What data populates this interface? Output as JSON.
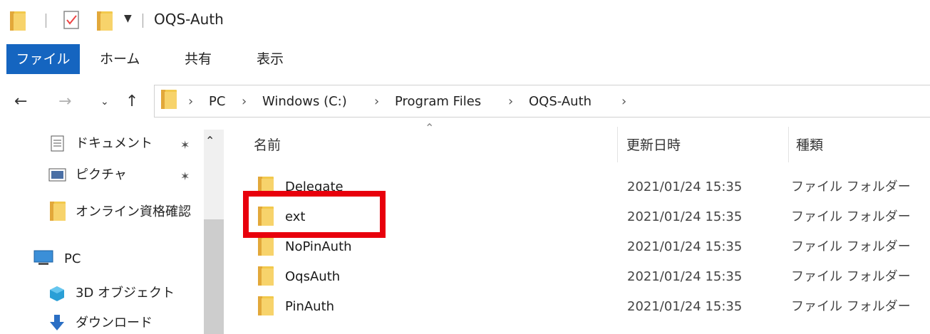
{
  "window": {
    "title": "OQS-Auth"
  },
  "ribbon": {
    "tabs": [
      "ファイル",
      "ホーム",
      "共有",
      "表示"
    ]
  },
  "address": {
    "crumbs": [
      "PC",
      "Windows (C:)",
      "Program Files",
      "OQS-Auth"
    ]
  },
  "sidebar": {
    "items": [
      {
        "label": "ドキュメント",
        "icon": "documents-icon",
        "pinned": true
      },
      {
        "label": "ピクチャ",
        "icon": "pictures-icon",
        "pinned": true
      },
      {
        "label": "オンライン資格確認",
        "icon": "folder-icon",
        "pinned": false
      },
      {
        "label": "PC",
        "icon": "pc-icon",
        "pinned": false
      },
      {
        "label": "3D オブジェクト",
        "icon": "3d-objects-icon",
        "pinned": false
      },
      {
        "label": "ダウンロード",
        "icon": "download-icon",
        "pinned": false
      }
    ]
  },
  "columns": {
    "name": "名前",
    "date": "更新日時",
    "type": "種類"
  },
  "files": [
    {
      "name": "Delegate",
      "date": "2021/01/24 15:35",
      "type": "ファイル フォルダー"
    },
    {
      "name": "ext",
      "date": "2021/01/24 15:35",
      "type": "ファイル フォルダー"
    },
    {
      "name": "NoPinAuth",
      "date": "2021/01/24 15:35",
      "type": "ファイル フォルダー"
    },
    {
      "name": "OqsAuth",
      "date": "2021/01/24 15:35",
      "type": "ファイル フォルダー"
    },
    {
      "name": "PinAuth",
      "date": "2021/01/24 15:35",
      "type": "ファイル フォルダー"
    }
  ],
  "colors": {
    "accent": "#1565c0",
    "highlight": "#e8000c",
    "folder": "#f2c94c"
  }
}
